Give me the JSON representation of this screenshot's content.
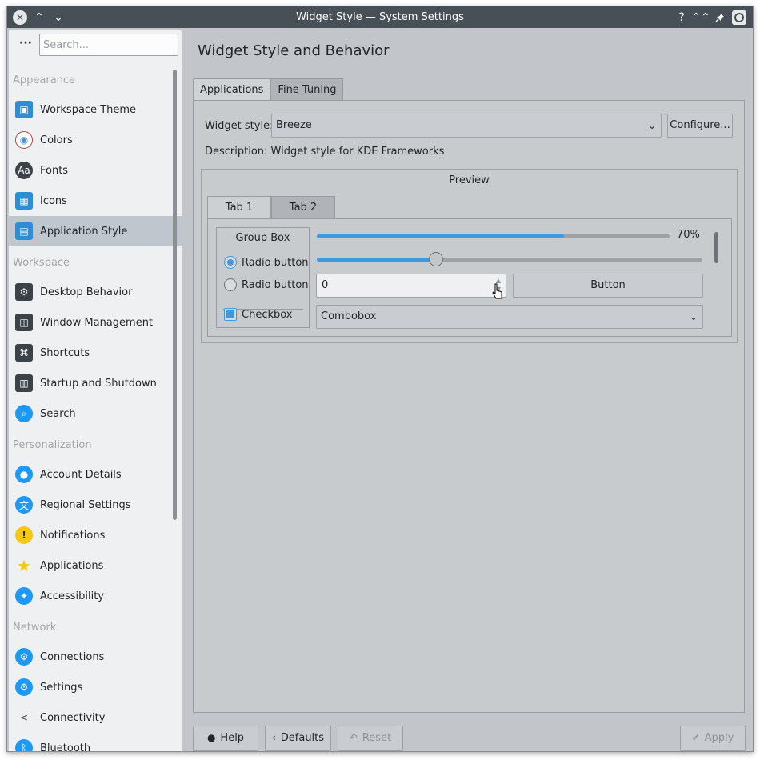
{
  "window": {
    "title": "Widget Style — System Settings",
    "titlebar_buttons": [
      "close-icon",
      "minimize-icon",
      "maximize-icon",
      "help-icon",
      "keep-above-icon",
      "pin-icon",
      "app-menu-icon"
    ]
  },
  "sidebar": {
    "menu_icon": "more-horizontal-icon",
    "search_placeholder": "Search...",
    "sections": [
      {
        "title": "Appearance",
        "items": [
          {
            "label": "Workspace Theme",
            "icon": "workspace-theme-icon",
            "color": "#2a8fd6"
          },
          {
            "label": "Colors",
            "icon": "colors-icon",
            "color": "#ffffff"
          },
          {
            "label": "Fonts",
            "icon": "fonts-icon",
            "color": "#3b4349"
          },
          {
            "label": "Icons",
            "icon": "icons-icon",
            "color": "#2a8fd6"
          },
          {
            "label": "Application Style",
            "icon": "application-style-icon",
            "color": "#2a8fd6",
            "selected": true
          }
        ]
      },
      {
        "title": "Workspace",
        "items": [
          {
            "label": "Desktop Behavior",
            "icon": "desktop-behavior-icon",
            "color": "#3b4349"
          },
          {
            "label": "Window Management",
            "icon": "window-management-icon",
            "color": "#3b4349"
          },
          {
            "label": "Shortcuts",
            "icon": "shortcuts-icon",
            "color": "#3b4349"
          },
          {
            "label": "Startup and Shutdown",
            "icon": "startup-shutdown-icon",
            "color": "#3b4349"
          },
          {
            "label": "Search",
            "icon": "search-icon",
            "color": "#1d99f3"
          }
        ]
      },
      {
        "title": "Personalization",
        "items": [
          {
            "label": "Account Details",
            "icon": "account-details-icon",
            "color": "#1d99f3"
          },
          {
            "label": "Regional Settings",
            "icon": "regional-settings-icon",
            "color": "#1d99f3"
          },
          {
            "label": "Notifications",
            "icon": "notifications-icon",
            "color": "#f5c518"
          },
          {
            "label": "Applications",
            "icon": "applications-star-icon",
            "color": "#f5c518"
          },
          {
            "label": "Accessibility",
            "icon": "accessibility-icon",
            "color": "#1d99f3"
          }
        ]
      },
      {
        "title": "Network",
        "items": [
          {
            "label": "Connections",
            "icon": "connections-icon",
            "color": "#1d99f3"
          },
          {
            "label": "Settings",
            "icon": "network-settings-icon",
            "color": "#1d99f3"
          },
          {
            "label": "Connectivity",
            "icon": "connectivity-icon",
            "color": "#eff0f1"
          },
          {
            "label": "Bluetooth",
            "icon": "bluetooth-icon",
            "color": "#1d99f3"
          }
        ]
      }
    ]
  },
  "main": {
    "page_title": "Widget Style and Behavior",
    "tabs": [
      {
        "label": "Applications",
        "active": true
      },
      {
        "label": "Fine Tuning",
        "active": false
      }
    ],
    "widget_style_label": "Widget style:",
    "widget_style_value": "Breeze",
    "configure_button": "Configure...",
    "description": "Description: Widget style for KDE Frameworks",
    "preview": {
      "title": "Preview",
      "tabs": [
        "Tab 1",
        "Tab 2"
      ],
      "group_box_title": "Group Box",
      "radio1": "Radio button",
      "radio2": "Radio button",
      "checkbox": "Checkbox",
      "progress_value": 0.7,
      "progress_text": "70%",
      "slider_value": 0.31,
      "spinbox_value": "0",
      "button": "Button",
      "combobox": "Combobox"
    }
  },
  "footer": {
    "help": "Help",
    "defaults": "Defaults",
    "reset": "Reset",
    "apply": "Apply"
  },
  "colors": {
    "accent": "#3d9ae0",
    "titlebar": "#475057",
    "sidebar_bg": "#eff0f1",
    "selected_item": "#bfc6cd"
  }
}
